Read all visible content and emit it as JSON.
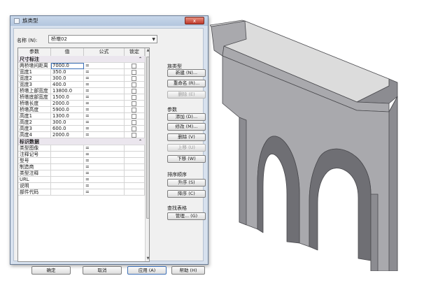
{
  "dialog": {
    "title": "族类型",
    "close_label": "x",
    "name_label": "名称 (N):",
    "name_value": "桥墩02"
  },
  "table": {
    "headers": {
      "param": "参数",
      "value": "值",
      "formula": "公式",
      "lock": "锁定"
    },
    "groups": [
      {
        "label": "尺寸标注",
        "rows": [
          {
            "name": "两桥墩间距离",
            "value": "7000.0",
            "formula": "="
          },
          {
            "name": "宽度1",
            "value": "350.0",
            "formula": "="
          },
          {
            "name": "宽度2",
            "value": "300.0",
            "formula": "="
          },
          {
            "name": "宽度3",
            "value": "400.0",
            "formula": "="
          },
          {
            "name": "桥墩上部宽度",
            "value": "13800.0",
            "formula": "="
          },
          {
            "name": "桥墩底部宽度",
            "value": "1500.0",
            "formula": "="
          },
          {
            "name": "桥墩长度",
            "value": "2000.0",
            "formula": "="
          },
          {
            "name": "桥墩高度",
            "value": "5900.0",
            "formula": "="
          },
          {
            "name": "高度1",
            "value": "1300.0",
            "formula": "="
          },
          {
            "name": "高度2",
            "value": "300.0",
            "formula": "="
          },
          {
            "name": "高度3",
            "value": "600.0",
            "formula": "="
          },
          {
            "name": "高度4",
            "value": "2000.0",
            "formula": "="
          }
        ]
      },
      {
        "label": "标识数据",
        "rows": [
          {
            "name": "类型图像",
            "value": "",
            "formula": "="
          },
          {
            "name": "注释记号",
            "value": "",
            "formula": "="
          },
          {
            "name": "型号",
            "value": "",
            "formula": "="
          },
          {
            "name": "制造商",
            "value": "",
            "formula": "="
          },
          {
            "name": "类型注释",
            "value": "",
            "formula": "="
          },
          {
            "name": "URL",
            "value": "",
            "formula": "="
          },
          {
            "name": "说明",
            "value": "",
            "formula": "="
          },
          {
            "name": "部件代码",
            "value": "",
            "formula": "="
          }
        ]
      }
    ],
    "collapse_glyph": "⌃"
  },
  "side": {
    "family_types_label": "族类型",
    "new_button": "新建 (N)...",
    "rename_button": "重命名 (R)...",
    "delete_type_button": "删除 (E)",
    "params_label": "参数",
    "add_button": "添加 (D)...",
    "modify_button": "修改 (M)...",
    "delete_param_button": "删除 (V)",
    "move_up_button": "上移 (U)",
    "move_down_button": "下移 (W)",
    "sort_label": "排序顺序",
    "ascending_button": "升序 (S)",
    "descending_button": "降序 (C)",
    "lookup_label": "查找表格",
    "manage_button": "管理... (G)"
  },
  "footer": {
    "ok": "确定",
    "cancel": "取消",
    "apply": "应用 (A)",
    "help": "帮助 (H)"
  },
  "colors": {
    "model_top": "#dcdcdc",
    "model_front": "#a9a9ad",
    "model_side": "#8c8c91",
    "model_dark": "#6f6f74",
    "edge": "#4a4a4e"
  }
}
